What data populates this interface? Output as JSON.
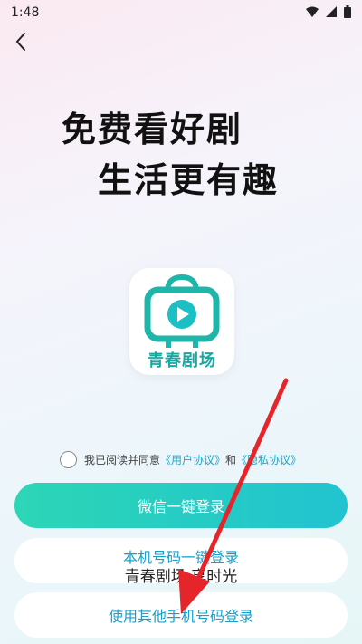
{
  "status_bar": {
    "time": "1:48"
  },
  "slogan": {
    "line1": "免费看好剧",
    "line2": "生活更有趣"
  },
  "logo": {
    "text": "青春剧场"
  },
  "agreement": {
    "prefix": "我已阅读并同意",
    "user_agreement": "《用户协议》",
    "and": "和",
    "privacy_policy": "《隐私协议》"
  },
  "buttons": {
    "wechat_login": "微信一键登录",
    "local_number_login": "本机号码一键登录",
    "other_phone_login": "使用其他手机号码登录"
  },
  "toast": "青春剧场 享时光",
  "colors": {
    "accent": "#21c3d0",
    "link": "#1aa7c5",
    "arrow": "#e5252a"
  }
}
